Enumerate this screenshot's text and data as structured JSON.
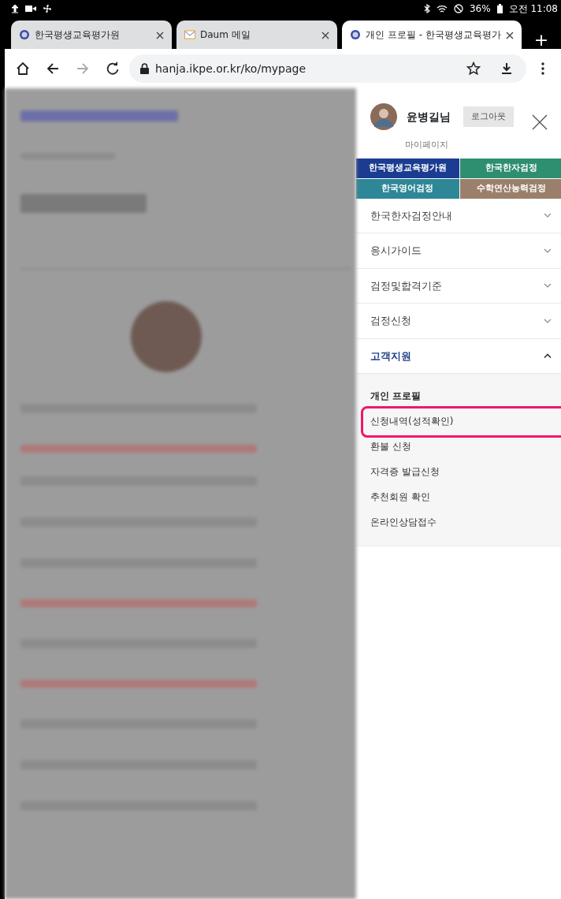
{
  "status_bar": {
    "battery": "36%",
    "time": "오전 11:08"
  },
  "tabs": [
    {
      "title": "한국평생교육평가원",
      "kind": "emblem",
      "selected": false
    },
    {
      "title": "Daum 메일",
      "kind": "mail",
      "selected": false
    },
    {
      "title": "개인 프로필 - 한국평생교육평가",
      "kind": "emblem",
      "selected": true
    }
  ],
  "new_tab": "+",
  "address_bar": {
    "url": "hanja.ikpe.or.kr/ko/mypage",
    "forward_disabled": true
  },
  "drawer": {
    "user_name": "윤병길님",
    "logout": "로그아웃",
    "mypage": "마이페이지",
    "sites": [
      {
        "label": "한국평생교육평가원",
        "color": "#1b3c91"
      },
      {
        "label": "한국한자검정",
        "color": "#2e8e70"
      },
      {
        "label": "한국영어검정",
        "color": "#2e8797"
      },
      {
        "label": "수학연산능력검정",
        "color": "#9a806b"
      }
    ],
    "menu": [
      {
        "label": "한국한자검정안내",
        "expanded": false
      },
      {
        "label": "응시가이드",
        "expanded": false
      },
      {
        "label": "검정및합격기준",
        "expanded": false
      },
      {
        "label": "검정신청",
        "expanded": false
      },
      {
        "label": "고객지원",
        "expanded": true,
        "children": [
          {
            "label": "개인 프로필",
            "selected": true,
            "highlighted": false
          },
          {
            "label": "신청내역(성적확인)",
            "selected": false,
            "highlighted": true
          },
          {
            "label": "환불 신청",
            "selected": false,
            "highlighted": false
          },
          {
            "label": "자격증 발급신청",
            "selected": false,
            "highlighted": false
          },
          {
            "label": "추천회원 확인",
            "selected": false,
            "highlighted": false
          },
          {
            "label": "온라인상담접수",
            "selected": false,
            "highlighted": false
          }
        ]
      }
    ]
  }
}
